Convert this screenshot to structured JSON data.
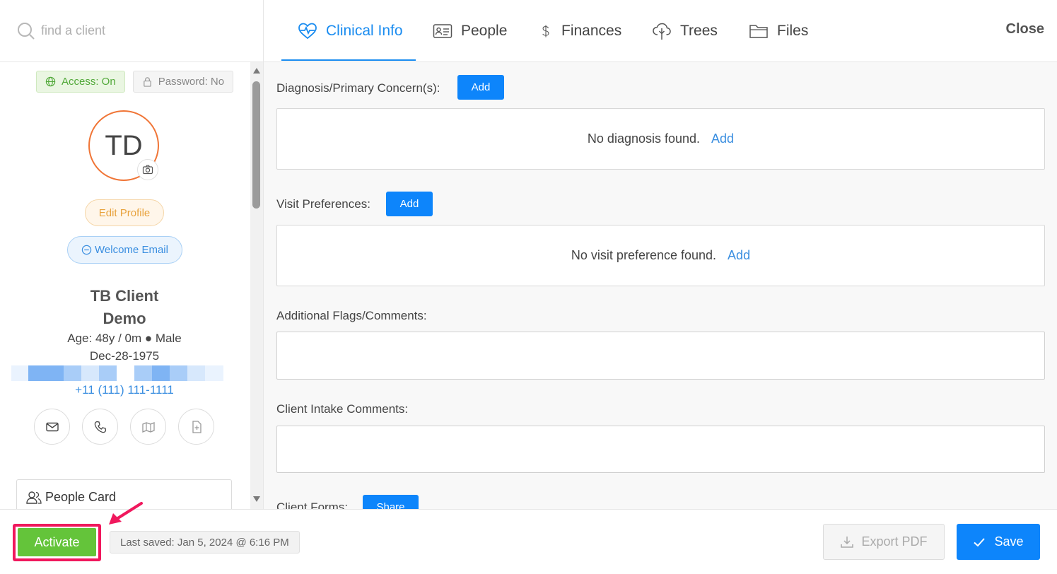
{
  "search": {
    "placeholder": "find a client"
  },
  "badges": {
    "access": "Access: On",
    "password": "Password: No"
  },
  "profile": {
    "initials": "TD",
    "edit_label": "Edit Profile",
    "welcome_label": "Welcome Email",
    "name_line1": "TB Client",
    "name_line2": "Demo",
    "age_gender": "Age: 48y / 0m ● Male",
    "dob": "Dec-28-1975",
    "phone": "+11 (111) 111-1111",
    "people_card": "People Card"
  },
  "tabs": [
    {
      "label": "Clinical Info",
      "icon": "heartbeat-icon"
    },
    {
      "label": "People",
      "icon": "id-card-icon"
    },
    {
      "label": "Finances",
      "icon": "dollar-icon"
    },
    {
      "label": "Trees",
      "icon": "tree-icon"
    },
    {
      "label": "Files",
      "icon": "folder-icon"
    }
  ],
  "close_label": "Close",
  "sections": {
    "diagnosis": {
      "label": "Diagnosis/Primary Concern(s):",
      "add": "Add",
      "empty": "No diagnosis found.",
      "empty_link": "Add"
    },
    "visit": {
      "label": "Visit Preferences:",
      "add": "Add",
      "empty": "No visit preference found.",
      "empty_link": "Add"
    },
    "flags": {
      "label": "Additional Flags/Comments:"
    },
    "intake": {
      "label": "Client Intake Comments:"
    },
    "forms": {
      "label": "Client Forms:",
      "share": "Share"
    }
  },
  "footer": {
    "activate": "Activate",
    "last_saved": "Last saved: Jan 5, 2024 @ 6:16 PM",
    "export": "Export PDF",
    "save": "Save"
  },
  "colors": {
    "primary": "#0d85fb",
    "activate": "#64c43a",
    "highlight": "#f0185d",
    "avatar_ring": "#f07536"
  }
}
